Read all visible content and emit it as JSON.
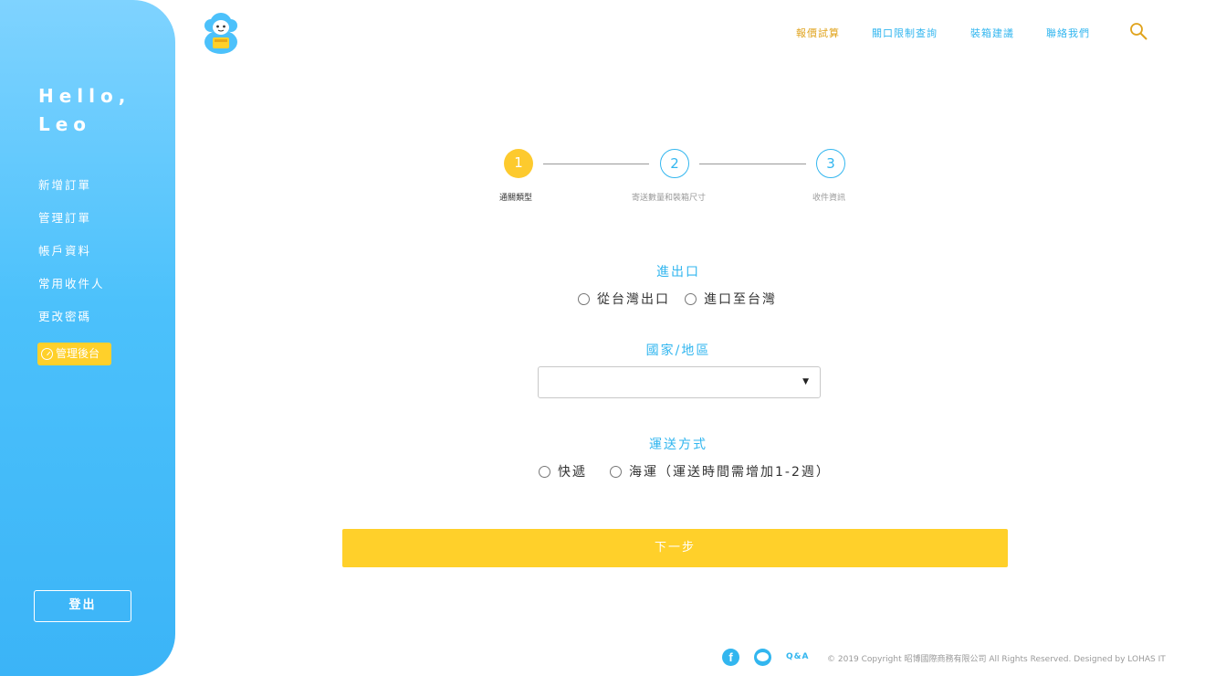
{
  "sidebar": {
    "greeting_line1": "Hello,",
    "greeting_line2": "Leo",
    "items": [
      {
        "label": "新增訂單"
      },
      {
        "label": "管理訂單"
      },
      {
        "label": "帳戶資料"
      },
      {
        "label": "常用收件人"
      },
      {
        "label": "更改密碼"
      }
    ],
    "admin_label": "管理後台",
    "logout_label": "登出"
  },
  "header": {
    "nav": [
      {
        "label": "報價試算"
      },
      {
        "label": "關口限制查詢"
      },
      {
        "label": "裝箱建議"
      },
      {
        "label": "聯絡我們"
      }
    ],
    "search_icon": "search-icon",
    "logo_icon": "sheep-logo"
  },
  "stepper": {
    "steps": [
      {
        "number": "1",
        "label": "通關類型"
      },
      {
        "number": "2",
        "label": "寄送數量和裝箱尺寸"
      },
      {
        "number": "3",
        "label": "收件資訊"
      }
    ]
  },
  "form": {
    "import_title": "進出口",
    "import_options": [
      "從台灣出口",
      "進口至台灣"
    ],
    "country_title": "國家/地區",
    "country_value": "",
    "ship_title": "運送方式",
    "ship_options": [
      "快遞",
      "海運（運送時間需增加1-2週）"
    ],
    "next_label": "下一步"
  },
  "footer": {
    "qa_label": "Q&A",
    "copyright": "© 2019 Copyright 昭博國際商務有限公司  All Rights Reserved. Designed by LOHAS IT"
  },
  "colors": {
    "primary_blue": "#32b6ef",
    "accent_yellow": "#ffd02a",
    "quote_orange": "#e0a31c"
  }
}
